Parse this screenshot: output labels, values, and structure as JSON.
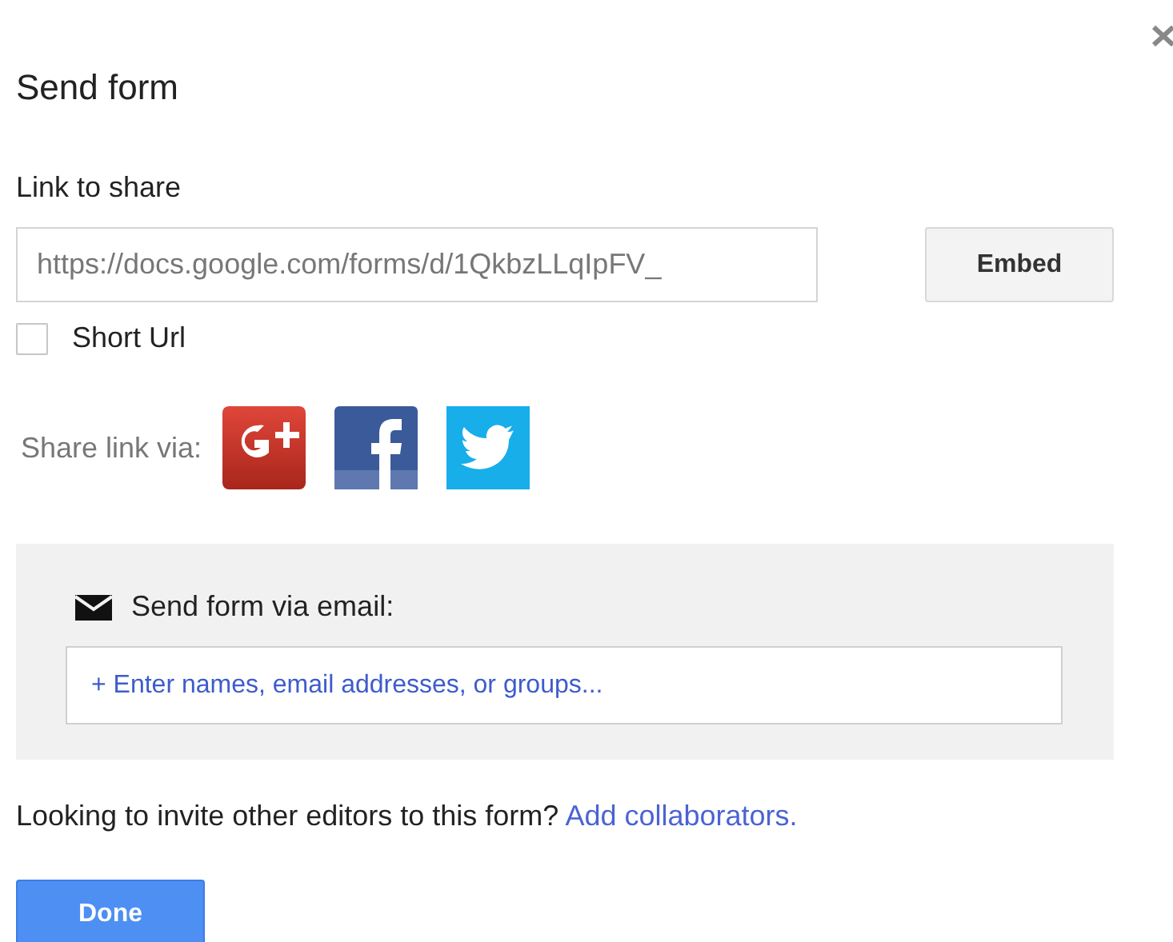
{
  "dialog": {
    "title": "Send form"
  },
  "link": {
    "label": "Link to share",
    "value": "https://docs.google.com/forms/d/1QkbzLLqIpFV_",
    "embed_button": "Embed"
  },
  "short_url": {
    "label": "Short Url",
    "checked": false
  },
  "share": {
    "label": "Share link via:"
  },
  "email": {
    "label": "Send form via email:",
    "placeholder": "+ Enter names, email addresses, or groups..."
  },
  "invite": {
    "text": "Looking to invite other editors to this form?",
    "link": "Add collaborators."
  },
  "buttons": [
    "Done"
  ]
}
